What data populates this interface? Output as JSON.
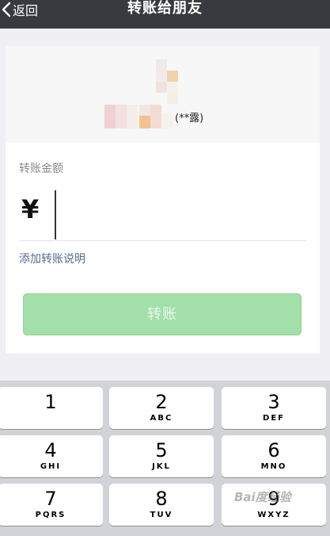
{
  "nav": {
    "back_label": "返回",
    "title": "转账给朋友"
  },
  "profile": {
    "masked_name": "(**露)"
  },
  "amount": {
    "label": "转账金额",
    "currency_symbol": "¥",
    "value": ""
  },
  "add_note_label": "添加转账说明",
  "transfer_button_label": "转账",
  "keypad": {
    "keys": [
      {
        "digit": "1",
        "letters": ""
      },
      {
        "digit": "2",
        "letters": "ABC"
      },
      {
        "digit": "3",
        "letters": "DEF"
      },
      {
        "digit": "4",
        "letters": "GHI"
      },
      {
        "digit": "5",
        "letters": "JKL"
      },
      {
        "digit": "6",
        "letters": "MNO"
      },
      {
        "digit": "7",
        "letters": "PQRS"
      },
      {
        "digit": "8",
        "letters": "TUV"
      },
      {
        "digit": "9",
        "letters": "WXYZ"
      }
    ]
  },
  "watermark_text": "Bai度经验",
  "colors": {
    "navbar": "#393a3f",
    "link": "#576b95",
    "button_disabled": "#a3dfa8"
  },
  "icons": {
    "back": "chevron-left-icon"
  }
}
